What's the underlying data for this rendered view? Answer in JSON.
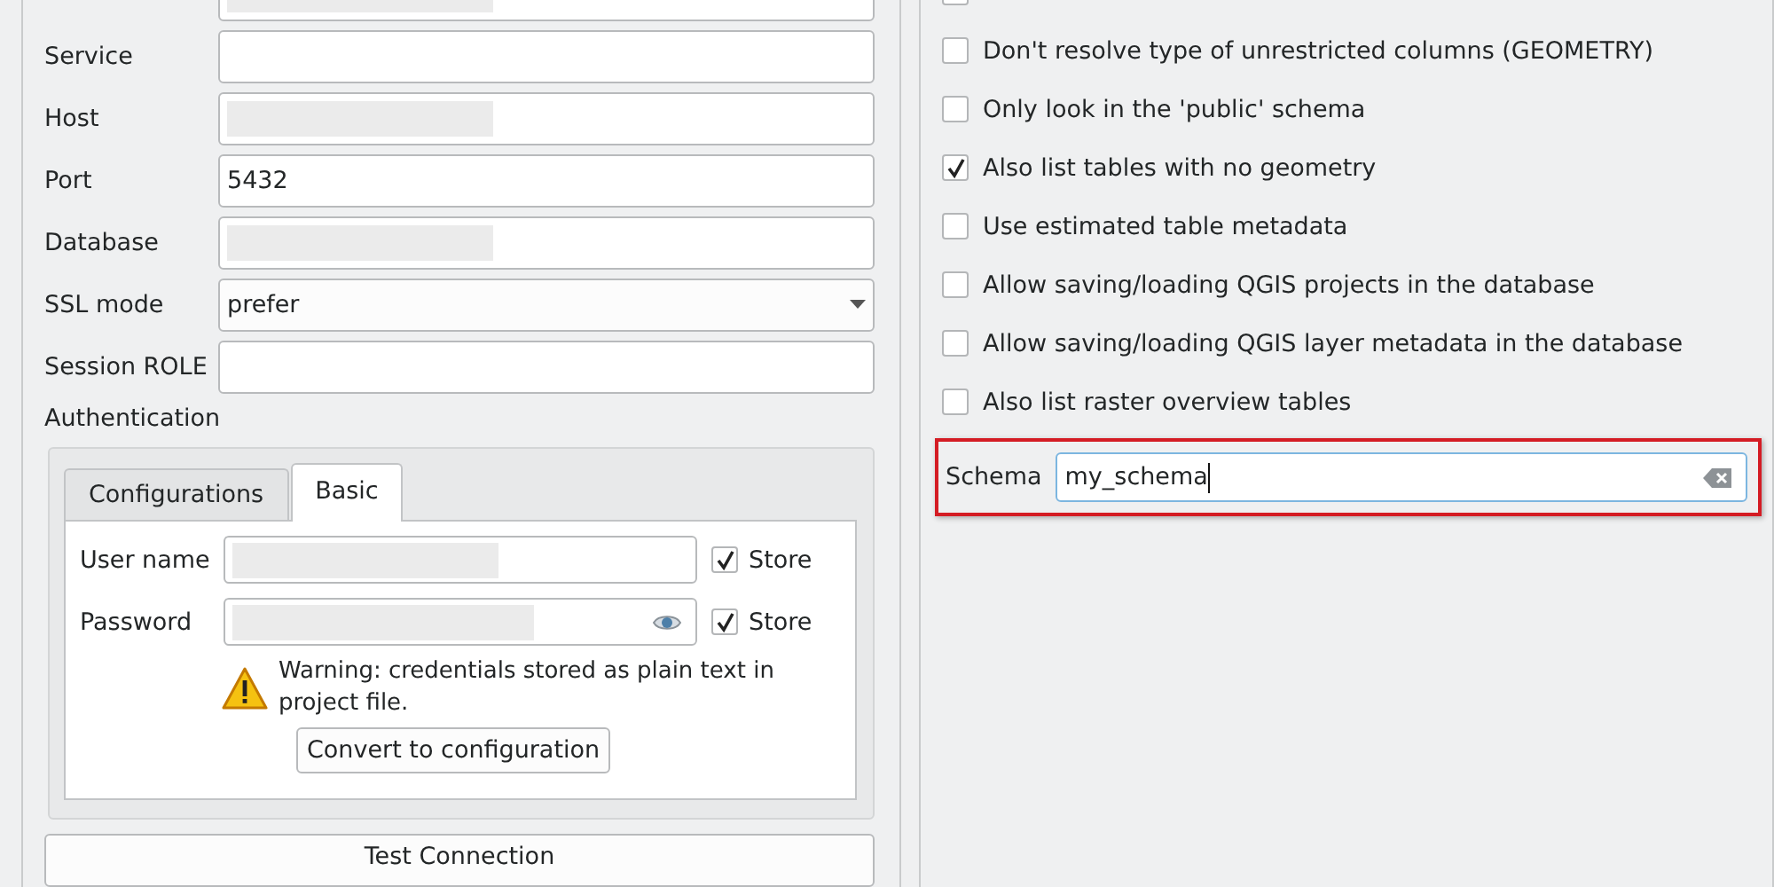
{
  "connection_fields": [
    {
      "redacted": true
    },
    {
      "label": "Service"
    },
    {
      "label": "Host",
      "redacted": true
    },
    {
      "label": "Port",
      "value": "5432"
    },
    {
      "label": "Database",
      "redacted": true
    },
    {
      "label": "SSL mode",
      "value": "prefer",
      "kind": "dropdown"
    },
    {
      "label": "Session ROLE"
    }
  ],
  "authentication": {
    "title": "Authentication",
    "tabs": [
      {
        "label": "Configurations",
        "selected": false
      },
      {
        "label": "Basic",
        "selected": true
      }
    ],
    "fields": [
      {
        "label": "User name",
        "redacted": true,
        "store_label": "Store",
        "store_checked": true,
        "kind": "text"
      },
      {
        "label": "Password",
        "redacted": true,
        "store_label": "Store",
        "store_checked": true,
        "kind": "password"
      }
    ],
    "warning": "Warning: credentials stored as plain text in project file.",
    "convert_button": "Convert to configuration"
  },
  "test_button": "Test Connection",
  "options": [
    {
      "checked": false
    },
    {
      "label": "Don't resolve type of unrestricted columns (GEOMETRY)",
      "checked": false
    },
    {
      "label": "Only look in the 'public' schema",
      "checked": false
    },
    {
      "label": "Also list tables with no geometry",
      "checked": true
    },
    {
      "label": "Use estimated table metadata",
      "checked": false
    },
    {
      "label": "Allow saving/loading QGIS projects in the database",
      "checked": false
    },
    {
      "label": "Allow saving/loading QGIS layer metadata in the database",
      "checked": false
    },
    {
      "label": "Also list raster overview tables",
      "checked": false
    }
  ],
  "schema": {
    "label": "Schema",
    "value": "my_schema",
    "highlighted": true
  }
}
